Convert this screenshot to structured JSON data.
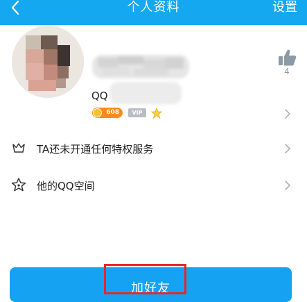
{
  "header": {
    "title": "个人资料",
    "settings_label": "设置",
    "back_icon": "chevron-left-icon",
    "background_color": "#14a8f0"
  },
  "profile": {
    "qq_label": "QQ",
    "level_badge": "608",
    "vip_badge": "VIP",
    "like_count": "4",
    "like_icon": "thumbs-up-icon"
  },
  "list": [
    {
      "label": "TA还未开通任何特权服务",
      "icon": "crown-icon"
    },
    {
      "label": "他的QQ空间",
      "icon": "star-icon"
    }
  ],
  "actions": {
    "add_friend_label": "加好友",
    "button_color": "#16a2f2",
    "highlight_color": "#e8262a"
  }
}
